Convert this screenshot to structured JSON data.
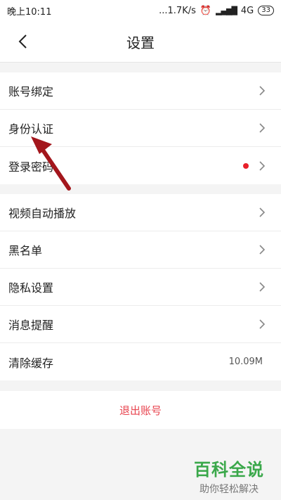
{
  "status_bar": {
    "time": "晚上10:11",
    "speed": "...1.7K/s",
    "network": "4G",
    "battery": "33"
  },
  "header": {
    "title": "设置"
  },
  "group1": [
    {
      "label": "账号绑定"
    },
    {
      "label": "身份认证"
    },
    {
      "label": "登录密码"
    }
  ],
  "group2": [
    {
      "label": "视频自动播放"
    },
    {
      "label": "黑名单"
    },
    {
      "label": "隐私设置"
    },
    {
      "label": "消息提醒"
    },
    {
      "label": "清除缓存",
      "value": "10.09M"
    }
  ],
  "logout": {
    "label": "退出账号"
  },
  "watermark": {
    "main": "百科全说",
    "sub": "助你轻松解决"
  },
  "colors": {
    "accent": "#e8444f",
    "dot": "#e8202a",
    "arrow": "#a3161c"
  }
}
